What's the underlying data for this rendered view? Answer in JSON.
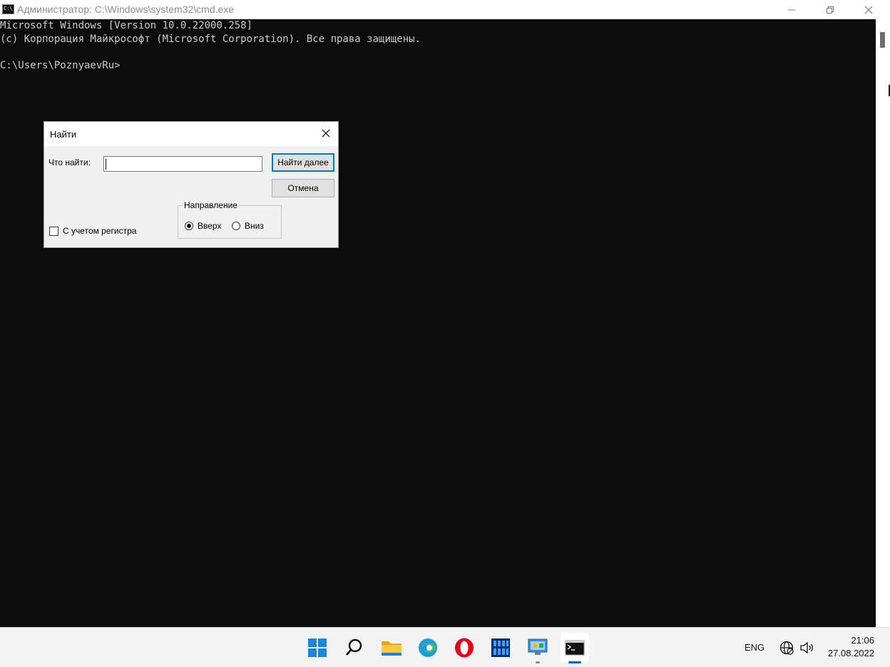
{
  "window": {
    "title": "Администратор: C:\\Windows\\system32\\cmd.exe",
    "icon": "cmd-icon",
    "icon_text": "C:\\",
    "controls": [
      "minimize-icon",
      "restore-icon",
      "close-icon"
    ]
  },
  "console": {
    "lines": [
      "Microsoft Windows [Version 10.0.22000.258]",
      "(c) Корпорация Майкрософт (Microsoft Corporation). Все права защищены.",
      "C:\\Users\\PoznyaevRu>"
    ],
    "background": "#0c0c0c",
    "foreground": "#cccccc"
  },
  "find_dialog": {
    "title": "Найти",
    "find_label": "Что найти:",
    "find_value": "",
    "find_next_label": "Найти далее",
    "cancel_label": "Отмена",
    "match_case_label": "С учетом регистра",
    "match_case_checked": false,
    "direction_label": "Направление",
    "direction_options": [
      "Вверх",
      "Вниз"
    ],
    "direction_selected": "Вверх"
  },
  "taskbar": {
    "icons": [
      "windows-start-icon",
      "search-icon",
      "file-explorer-icon",
      "edge-icon",
      "opera-icon",
      "app-icon",
      "control-panel-icon",
      "cmd-icon"
    ],
    "language": "ENG",
    "time": "21:06",
    "date": "27.08.2022",
    "accent": "#0067c0"
  }
}
